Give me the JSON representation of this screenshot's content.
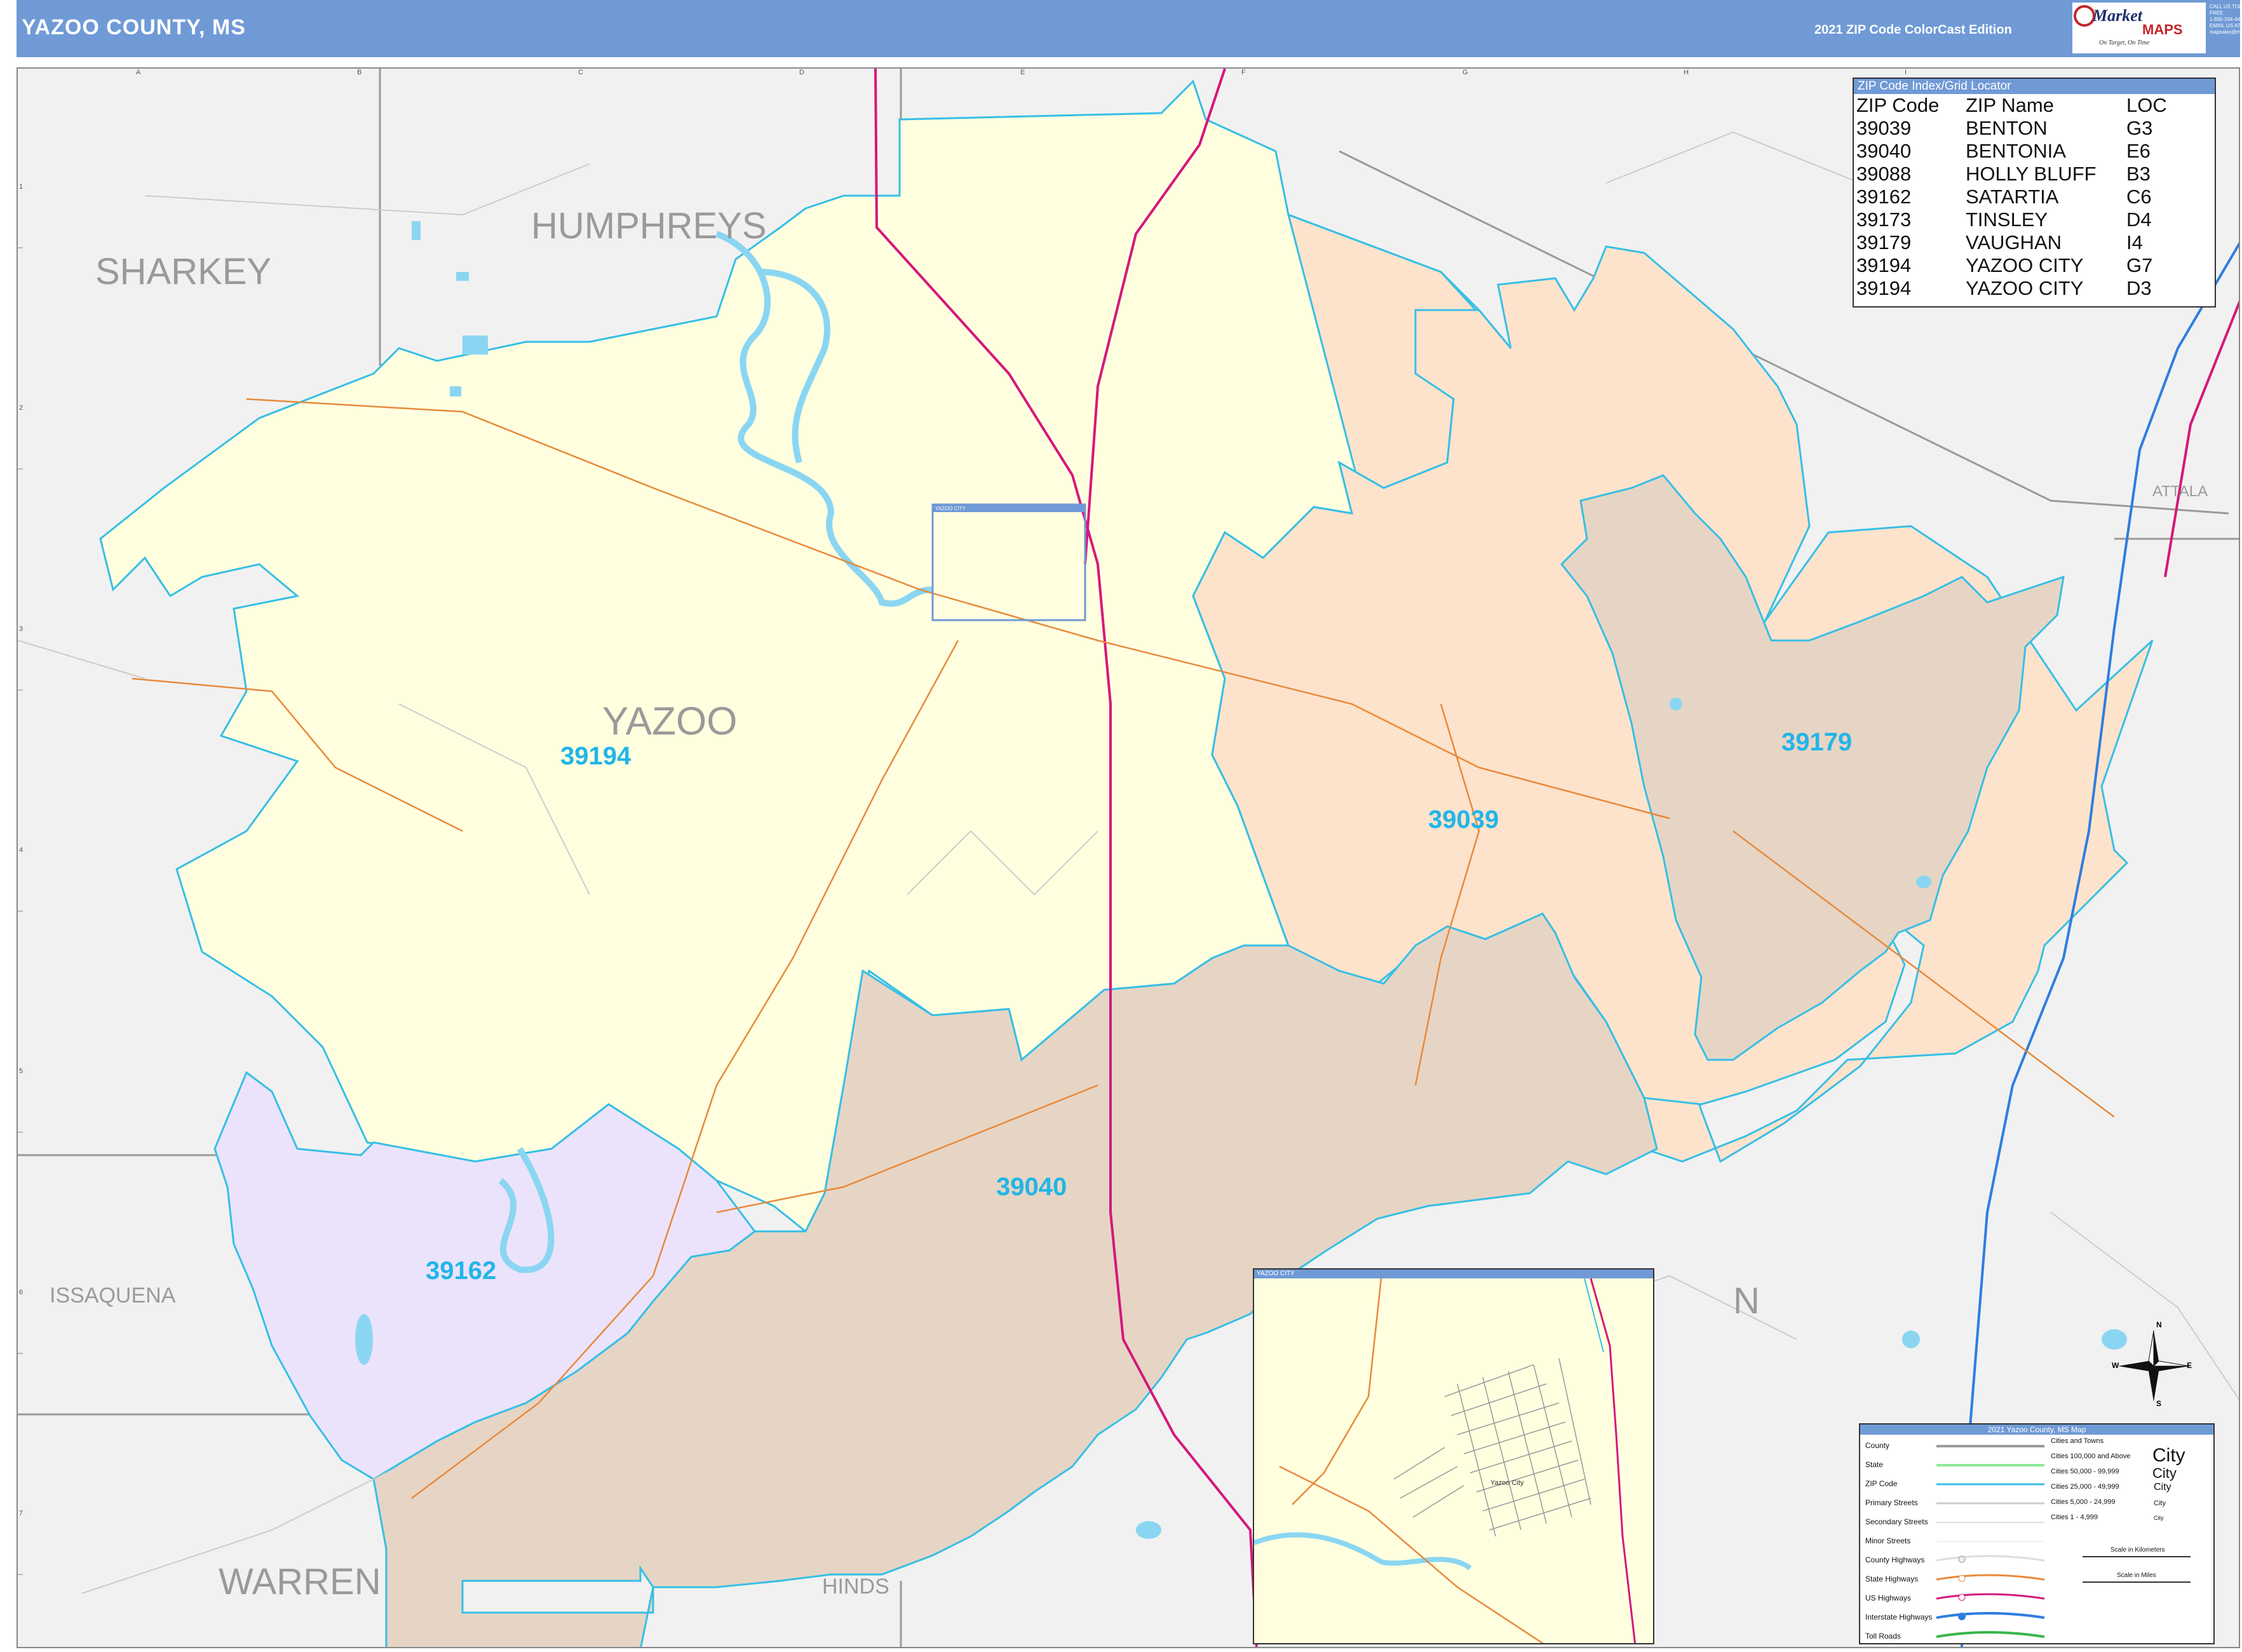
{
  "header": {
    "title": "YAZOO COUNTY, MS",
    "edition": "2021 ZIP Code ColorCast Edition",
    "logo_text": "Market",
    "logo_text2": "MAPS",
    "tagline": "On Target, On Time",
    "contact": [
      "CALL US TOLL FREE",
      "1-800-334-4470",
      "EMAIL US AT",
      "mapsales@marketmaps.com"
    ]
  },
  "colors": {
    "header_bg": "#6f9ad6",
    "zip_39194": "#ffffe0",
    "zip_39039": "#fde3cc",
    "zip_39040": "#e6d5c5",
    "zip_39179": "#e6d5c5",
    "zip_39162": "#ebe3fb",
    "zip_boundary": "#36bfe6",
    "outside": "#f1f1f1",
    "us_highway": "#d6177b",
    "state_highway": "#e8893a",
    "interstate": "#2f7de0",
    "water": "#8ad6f2"
  },
  "grid": {
    "columns": [
      "A",
      "B",
      "C",
      "D",
      "E",
      "F",
      "G",
      "H",
      "I"
    ],
    "rows": [
      "1",
      "2",
      "3",
      "4",
      "5",
      "6",
      "7"
    ]
  },
  "map_labels": {
    "counties": [
      "SHARKEY",
      "HUMPHREYS",
      "ISSAQUENA",
      "WARREN",
      "HINDS",
      "ATTALA",
      "N"
    ],
    "county_main": "YAZOO",
    "zips": [
      "39194",
      "39039",
      "39179",
      "39040",
      "39162"
    ],
    "inset_box_label": "YAZOO CITY"
  },
  "zip_index": {
    "title": "ZIP Code Index/Grid Locator",
    "headers": [
      "ZIP Code",
      "ZIP Name",
      "LOC"
    ],
    "rows": [
      [
        "39039",
        "BENTON",
        "G3"
      ],
      [
        "39040",
        "BENTONIA",
        "E6"
      ],
      [
        "39088",
        "HOLLY BLUFF",
        "B3"
      ],
      [
        "39162",
        "SATARTIA",
        "C6"
      ],
      [
        "39173",
        "TINSLEY",
        "D4"
      ],
      [
        "39179",
        "VAUGHAN",
        "I4"
      ],
      [
        "39194",
        "YAZOO CITY",
        "G7"
      ],
      [
        "39194",
        "YAZOO CITY",
        "D3"
      ]
    ]
  },
  "inset": {
    "title": "YAZOO CITY",
    "city_label": "Yazoo City"
  },
  "legend": {
    "title": "2021 Yazoo County, MS Map",
    "items": [
      "County",
      "State",
      "ZIP Code",
      "Primary Streets",
      "Secondary Streets",
      "Minor Streets",
      "County Highways",
      "State Highways",
      "US Highways",
      "Interstate Highways",
      "Toll Roads"
    ],
    "cities_title": "Cities and Towns",
    "cities": [
      {
        "label": "Cities 100,000 and Above",
        "sym": "City"
      },
      {
        "label": "Cities 50,000 - 99,999",
        "sym": "City"
      },
      {
        "label": "Cities 25,000 - 49,999",
        "sym": "City"
      },
      {
        "label": "Cities 5,000 - 24,999",
        "sym": "City"
      },
      {
        "label": "Cities 1 - 4,999",
        "sym": "City"
      }
    ],
    "scale_km": "Scale in Kilometers",
    "scale_mi": "Scale in Miles"
  },
  "compass": {
    "n": "N",
    "s": "S",
    "e": "E",
    "w": "W"
  }
}
